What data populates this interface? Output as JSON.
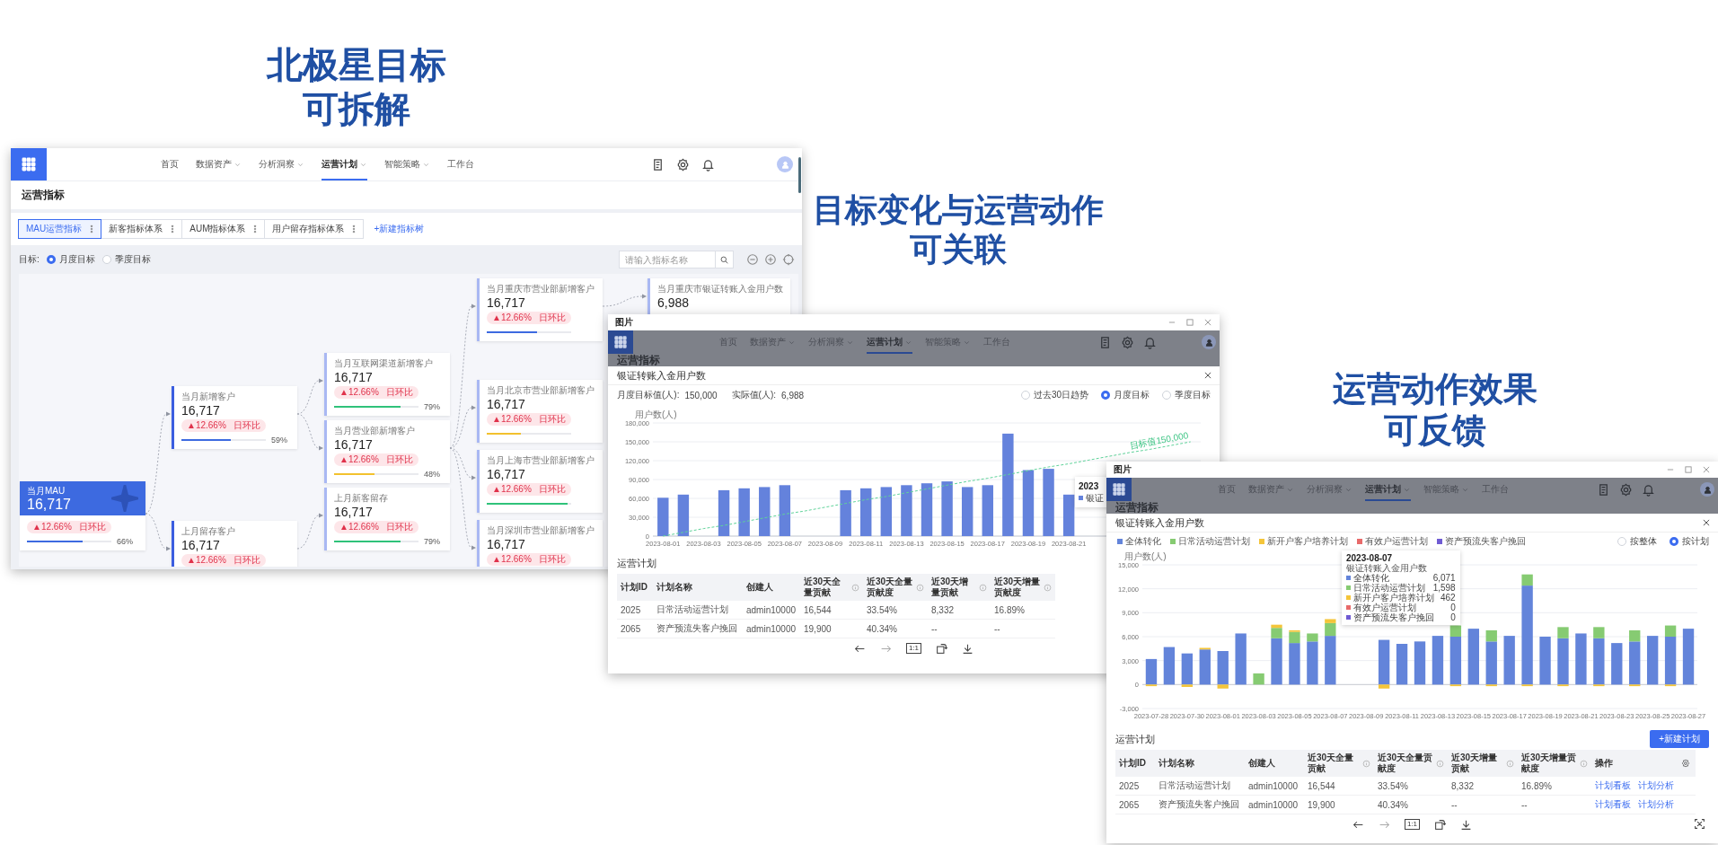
{
  "slide_titles": [
    {
      "lines": [
        "北极星目标",
        "可拆解"
      ]
    },
    {
      "lines": [
        "目标变化与运营动作",
        "可关联"
      ]
    },
    {
      "lines": [
        "运营动作效果",
        "可反馈"
      ]
    }
  ],
  "tree_screen": {
    "nav": {
      "items": [
        {
          "label": "首页",
          "dropdown": false,
          "selected": false
        },
        {
          "label": "数据资产",
          "dropdown": true,
          "selected": false
        },
        {
          "label": "分析洞察",
          "dropdown": true,
          "selected": false
        },
        {
          "label": "运营计划",
          "dropdown": true,
          "selected": true
        },
        {
          "label": "智能策略",
          "dropdown": true,
          "selected": false
        },
        {
          "label": "工作台",
          "dropdown": false,
          "selected": false
        }
      ]
    },
    "page_title": "运营指标",
    "tabs": [
      {
        "label": "MAU运营指标",
        "selected": true
      },
      {
        "label": "新客指标体系",
        "selected": false
      },
      {
        "label": "AUM指标体系",
        "selected": false
      },
      {
        "label": "用户留存指标体系",
        "selected": false
      }
    ],
    "new_tab_link": "+新建指标树",
    "target_label": "目标:",
    "target_options": [
      {
        "label": "月度目标",
        "selected": true
      },
      {
        "label": "季度目标",
        "selected": false
      }
    ],
    "search": {
      "placeholder": "请输入指标名称"
    },
    "tree": {
      "title": "当月MAU",
      "value": "16,717",
      "change": "▲12.66%",
      "change_label": "日环比",
      "level": 0.66,
      "percent": "66%",
      "color": "#3d6ae0",
      "children": [
        {
          "title": "当月新增客户",
          "value": "16,717",
          "change": "▲12.66%",
          "change_label": "日环比",
          "level": 0.59,
          "percent": "59%",
          "color": "#3d6ae0",
          "children": [
            {
              "title": "当月互联网渠道新增客户",
              "value": "16,717",
              "change": "▲12.66%",
              "change_label": "日环比",
              "level": 0.79,
              "percent": "79%",
              "color": "#2fc27a"
            },
            {
              "title": "当月营业部新增客户",
              "value": "16,717",
              "change": "▲12.66%",
              "change_label": "日环比",
              "level": 0.48,
              "percent": "48%",
              "color": "#f2c12e",
              "children": [
                {
                  "title": "当月重庆市营业部新增客户",
                  "value": "16,717",
                  "change": "▲12.66%",
                  "change_label": "日环比",
                  "level": 0.6,
                  "color": "#3d6ae0",
                  "children": [
                    {
                      "title": "当月重庆市银证转账入金用户数",
                      "value": "6,988"
                    }
                  ]
                },
                {
                  "title": "当月北京市营业部新增客户",
                  "value": "16,717",
                  "change": "▲12.66%",
                  "change_label": "日环比",
                  "level": 0.4,
                  "color": "#f2c12e"
                },
                {
                  "title": "当月上海市营业部新增客户",
                  "value": "16,717",
                  "change": "▲12.66%",
                  "change_label": "日环比",
                  "level": 0.96,
                  "color": "#2fc27a"
                },
                {
                  "title": "当月深圳市营业部新增客户",
                  "value": "16,717",
                  "change": "▲12.66%",
                  "change_label": "日环比"
                }
              ]
            }
          ]
        },
        {
          "title": "上月留存客户",
          "value": "16,717",
          "change": "▲12.66%",
          "change_label": "日环比",
          "children": [
            {
              "title": "上月新客留存",
              "value": "16,717",
              "change": "▲12.66%",
              "change_label": "日环比",
              "level": 0.79,
              "percent": "79%",
              "color": "#2fc27a"
            }
          ]
        }
      ]
    }
  },
  "trend_window": {
    "title": "图片",
    "nav": {
      "items": [
        {
          "label": "首页",
          "dropdown": false,
          "selected": false
        },
        {
          "label": "数据资产",
          "dropdown": true,
          "selected": false
        },
        {
          "label": "分析洞察",
          "dropdown": true,
          "selected": false
        },
        {
          "label": "运营计划",
          "dropdown": true,
          "selected": true
        },
        {
          "label": "智能策略",
          "dropdown": true,
          "selected": false
        },
        {
          "label": "工作台",
          "dropdown": false,
          "selected": false
        }
      ]
    },
    "page_title": "运营指标",
    "panel_title": "银证转账入金用户数",
    "stats": [
      {
        "label": "月度目标值(人):",
        "value": "150,000"
      },
      {
        "label": "实际值(人):",
        "value": "6,988"
      }
    ],
    "view_options": [
      {
        "label": "过去30日趋势",
        "selected": false
      },
      {
        "label": "月度目标",
        "selected": true
      },
      {
        "label": "季度目标",
        "selected": false
      }
    ],
    "chart_data": {
      "type": "bar",
      "ylabel": "用户数(人)",
      "grid": true,
      "categories": [
        "2023-08-01",
        null,
        "2023-08-03",
        null,
        "2023-08-05",
        null,
        "2023-08-07",
        null,
        "2023-08-09",
        null,
        "2023-08-11",
        null,
        "2023-08-13",
        null,
        "2023-08-15",
        null,
        "2023-08-17",
        null,
        "2023-08-19",
        null,
        "2023-08-21",
        null,
        null,
        null,
        null,
        null,
        null
      ],
      "series": [
        {
          "color": "#6482dc",
          "values": [
            61000,
            66000,
            null,
            73000,
            76000,
            78000,
            81000,
            null,
            null,
            73000,
            76000,
            78000,
            81000,
            84000,
            87000,
            78000,
            81000,
            163000,
            105000,
            107000,
            66000,
            null,
            null,
            null,
            null,
            null,
            null
          ]
        },
        {
          "name": "目标值150,000",
          "type": "line",
          "line_style": "dashed",
          "color": "#5fd39a",
          "values": [
            0,
            6000,
            12000,
            17000,
            23000,
            29000,
            35000,
            40000,
            46000,
            52000,
            58000,
            63000,
            69000,
            75000,
            81000,
            87000,
            92000,
            98000,
            104000,
            110000,
            115000,
            121000,
            127000,
            133000,
            138000,
            144000,
            150000
          ]
        }
      ],
      "ylim": [
        0,
        180000
      ],
      "yticks": [
        {
          "value": 0,
          "label": "0"
        },
        {
          "value": 30000,
          "label": "30,000"
        },
        {
          "value": 60000,
          "label": "60,000"
        },
        {
          "value": 90000,
          "label": "90,000"
        },
        {
          "value": 120000,
          "label": "120,000"
        },
        {
          "value": 150000,
          "label": "150,000"
        },
        {
          "value": 180000,
          "label": "180,000"
        }
      ]
    },
    "tooltip": {
      "title": "2023",
      "series": "银证",
      "color": "#6482dc"
    },
    "plan_title": "运营计划",
    "table": {
      "columns": [
        {
          "label": "计划ID",
          "info": false
        },
        {
          "label": "计划名称",
          "info": false
        },
        {
          "label": "创建人",
          "info": false
        },
        {
          "label": "近30天全量贡献",
          "info": true
        },
        {
          "label": "近30天全量贡献度",
          "info": true
        },
        {
          "label": "近30天增量贡献",
          "info": true
        },
        {
          "label": "近30天增量贡献度",
          "info": true
        }
      ],
      "rows": [
        {
          "cells": [
            "2025",
            "日常活动运营计划",
            "admin10000",
            "16,544",
            "33.54%",
            "8,332",
            "16.89%"
          ]
        },
        {
          "cells": [
            "2065",
            "资产预流失客户挽回",
            "admin10000",
            "19,900",
            "40.34%",
            "--",
            "--"
          ]
        }
      ]
    },
    "actual_size": "1:1"
  },
  "plan_window": {
    "title": "图片",
    "nav": {
      "items": [
        {
          "label": "首页",
          "dropdown": false,
          "selected": false
        },
        {
          "label": "数据资产",
          "dropdown": true,
          "selected": false
        },
        {
          "label": "分析洞察",
          "dropdown": true,
          "selected": false
        },
        {
          "label": "运营计划",
          "dropdown": true,
          "selected": true
        },
        {
          "label": "智能策略",
          "dropdown": true,
          "selected": false
        },
        {
          "label": "工作台",
          "dropdown": false,
          "selected": false
        }
      ]
    },
    "page_title": "运营指标",
    "panel_title": "银证转账入金用户数",
    "view_options": [
      {
        "label": "按整体",
        "selected": false
      },
      {
        "label": "按计划",
        "selected": true
      }
    ],
    "chart_data": {
      "type": "bar",
      "stacked": true,
      "ylabel": "用户数(人)",
      "grid": true,
      "legend": "top",
      "categories": [
        "2023-07-28",
        null,
        "2023-07-30",
        null,
        "2023-08-01",
        null,
        "2023-08-03",
        null,
        "2023-08-05",
        null,
        "2023-08-07",
        null,
        "2023-08-09",
        null,
        "2023-08-11",
        null,
        "2023-08-13",
        null,
        "2023-08-15",
        null,
        "2023-08-17",
        null,
        "2023-08-19",
        null,
        "2023-08-21",
        null,
        "2023-08-23",
        null,
        "2023-08-25",
        null,
        "2023-08-27"
      ],
      "series": [
        {
          "name": "全体转化",
          "color": "#6384da",
          "values": [
            3200,
            4700,
            3900,
            4400,
            4200,
            6400,
            null,
            5800,
            5200,
            5400,
            6100,
            null,
            null,
            5600,
            5100,
            5400,
            6100,
            6000,
            7000,
            5400,
            6100,
            12400,
            6000,
            5800,
            6400,
            5800,
            5200,
            5400,
            6100,
            6000,
            7000
          ]
        },
        {
          "name": "日常活动运营计划",
          "color": "#86cb72",
          "values": [
            null,
            null,
            null,
            null,
            null,
            null,
            1400,
            1300,
            1400,
            1000,
            1600,
            null,
            null,
            null,
            null,
            null,
            null,
            1400,
            null,
            1400,
            null,
            1400,
            null,
            1400,
            null,
            1400,
            null,
            1400,
            null,
            1400,
            null
          ]
        },
        {
          "name": "新开户客户培养计划",
          "color": "#f4c53a",
          "values": [
            -200,
            null,
            -300,
            200,
            -500,
            null,
            null,
            400,
            200,
            null,
            500,
            null,
            null,
            -500,
            null,
            null,
            null,
            -200,
            null,
            -200,
            null,
            -200,
            null,
            -200,
            null,
            -200,
            null,
            -200,
            null,
            -200,
            null
          ]
        },
        {
          "name": "有效户运营计划",
          "color": "#e86a6a",
          "values": [
            0,
            0,
            0,
            0,
            0,
            0,
            0,
            0,
            0,
            0,
            0,
            0,
            0,
            0,
            0,
            0,
            0,
            0,
            0,
            0,
            0,
            0,
            0,
            0,
            0,
            0,
            0,
            0,
            0,
            0,
            0
          ]
        },
        {
          "name": "资产预流失客户挽回",
          "color": "#6f5bd3",
          "values": [
            0,
            0,
            0,
            0,
            0,
            0,
            0,
            0,
            0,
            0,
            0,
            0,
            0,
            0,
            0,
            0,
            0,
            0,
            0,
            0,
            0,
            0,
            0,
            0,
            0,
            0,
            0,
            0,
            0,
            0,
            0
          ]
        }
      ],
      "ylim": [
        -3000,
        15000
      ],
      "yticks": [
        {
          "value": -3000,
          "label": "-3,000"
        },
        {
          "value": 0,
          "label": "0"
        },
        {
          "value": 3000,
          "label": "3,000"
        },
        {
          "value": 6000,
          "label": "6,000"
        },
        {
          "value": 9000,
          "label": "9,000"
        },
        {
          "value": 12000,
          "label": "12,000"
        },
        {
          "value": 15000,
          "label": "15,000"
        }
      ]
    },
    "tooltip": {
      "title": "2023-08-07",
      "subtitle": "银证转账入金用户数",
      "rows": [
        {
          "name": "全体转化",
          "value": "6,071",
          "color": "#6384da"
        },
        {
          "name": "日常活动运营计划",
          "value": "1,598",
          "color": "#86cb72"
        },
        {
          "name": "新开户客户培养计划",
          "value": "462",
          "color": "#f4c53a"
        },
        {
          "name": "有效户运营计划",
          "value": "0",
          "color": "#e86a6a"
        },
        {
          "name": "资产预流失客户挽回",
          "value": "0",
          "color": "#6f5bd3"
        }
      ]
    },
    "plan_title": "运营计划",
    "new_plan_button": "+新建计划",
    "table": {
      "settings_column": true,
      "columns": [
        {
          "label": "计划ID",
          "info": false
        },
        {
          "label": "计划名称",
          "info": false
        },
        {
          "label": "创建人",
          "info": false
        },
        {
          "label": "近30天全量贡献",
          "info": true
        },
        {
          "label": "近30天全量贡献度",
          "info": true
        },
        {
          "label": "近30天增量贡献",
          "info": true
        },
        {
          "label": "近30天增量贡献度",
          "info": true
        },
        {
          "label": "操作",
          "info": false
        }
      ],
      "rows": [
        {
          "cells": [
            "2025",
            "日常活动运营计划",
            "admin10000",
            "16,544",
            "33.54%",
            "8,332",
            "16.89%"
          ],
          "actions": [
            "计划看板",
            "计划分析"
          ]
        },
        {
          "cells": [
            "2065",
            "资产预流失客户挽回",
            "admin10000",
            "19,900",
            "40.34%",
            "--",
            "--"
          ],
          "actions": [
            "计划看板",
            "计划分析"
          ]
        }
      ]
    },
    "actual_size": "1:1"
  }
}
